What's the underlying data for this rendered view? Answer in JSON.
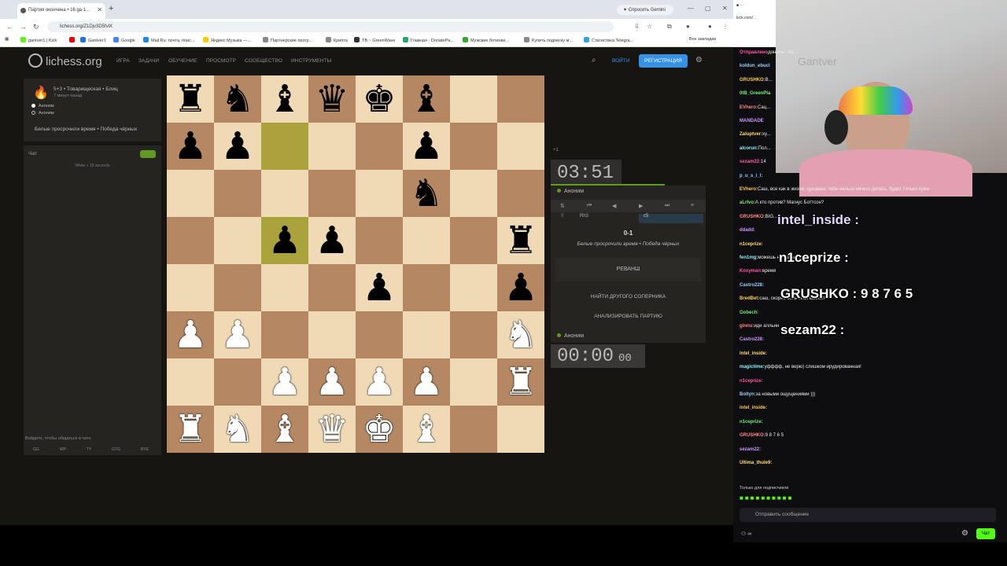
{
  "browser": {
    "tab_title": "Партия окончена • 16:ga 1...",
    "gemini": "Спросить Gemini",
    "url": "lichess.org/Z1Djv3D5fvlX",
    "bookmarks": [
      "gantver1 | Kick",
      "",
      "Gantver1",
      "Google",
      "Mail.Ru: почта, поис...",
      "Яндекс Музыка —...",
      "Партнерские прогр...",
      "Крипта",
      "TB ~ GreenWave",
      "Главная - DonatePa...",
      "Мужские ботинки...",
      "Купить подписку м...",
      "Статистика Telegra...",
      "Все закладки"
    ]
  },
  "lichess": {
    "logo": "lichess.org",
    "nav": [
      "ИГРА",
      "ЗАДАЧИ",
      "ОБУЧЕНИЕ",
      "ПРОСМОТР",
      "СООБЩЕСТВО",
      "ИНСТРУМЕНТЫ"
    ],
    "login": "ВОЙТИ",
    "register": "РЕГИСТРАЦИЯ"
  },
  "game": {
    "type": "5+3 • Товарищеская • Блиц",
    "time_ago": "7 минут назад",
    "white_player": "Аноним",
    "black_player": "Аноним",
    "result_text": "Белые просрочили время • Победа чёрных",
    "score": "0-1",
    "move_no": "9",
    "move_white": "Rh3",
    "move_black": "c5",
    "top_clock": "03:51",
    "bottom_clock": "00:00",
    "bottom_clock_tenths": "00",
    "top_player": "Аноним",
    "bottom_player": "Аноним",
    "rematch": "РЕВАНШ",
    "new_opponent": "НАЙТИ ДРУГОГО СОПЕРНИКА",
    "analyze": "АНАЛИЗИРОВАТЬ ПАРТИЮ",
    "plus": "+1"
  },
  "chat": {
    "title": "Чат",
    "notice": "White + 15 seconds",
    "placeholder": "Войдите, чтобы общаться в чате",
    "quick": [
      "GG",
      "WP",
      "TY",
      "GTG",
      "BYE"
    ]
  },
  "board": [
    [
      "bR",
      "bN",
      "bB",
      "bQ",
      "bK",
      "bB",
      "",
      ""
    ],
    [
      "bP",
      "bP",
      "",
      "",
      "",
      "bP",
      "",
      ""
    ],
    [
      "",
      "",
      "",
      "",
      "",
      "bN",
      "",
      ""
    ],
    [
      "",
      "",
      "bP",
      "bP",
      "",
      "",
      "",
      "bR"
    ],
    [
      "",
      "",
      "",
      "",
      "bP",
      "",
      "",
      "bP"
    ],
    [
      "wP",
      "wP",
      "",
      "",
      "",
      "",
      "",
      "wN"
    ],
    [
      "",
      "",
      "wP",
      "wP",
      "wP",
      "wP",
      "",
      "wR"
    ],
    [
      "wR",
      "wN",
      "wB",
      "wQ",
      "wK",
      "wB",
      "",
      ""
    ]
  ],
  "highlights": [
    "c7",
    "c5"
  ],
  "stream": {
    "pip_site": "kick.com/...",
    "messages": [
      {
        "user": "Отправлено",
        "text": "донаты - htt..."
      },
      {
        "user": "koldun_ebucl",
        "text": ""
      },
      {
        "user": "GRUSHKO:",
        "text": "В..."
      },
      {
        "user": "0tB_GreenPla",
        "text": ""
      },
      {
        "user": "EVhero:",
        "text": "Сац..."
      },
      {
        "user": "MANDADE",
        "text": ""
      },
      {
        "user": "Zaluptver:",
        "text": "ху..."
      },
      {
        "user": "alcorun:",
        "text": "Пол..."
      },
      {
        "user": "sezam22:",
        "text": "14"
      },
      {
        "user": "p_u_s_i_l:",
        "text": ""
      },
      {
        "user": "EVhero:",
        "text": "Саш, все как в жизни, цукцванг, тебе нельзя ничего делать, будет только хуже"
      },
      {
        "user": "aLrIvo:",
        "text": "А кто против? Магнус Боттсон?"
      },
      {
        "user": "GRUSHKO:",
        "text": "BIG..."
      },
      {
        "user": "ddadd:",
        "text": ""
      },
      {
        "user": "n1ceprize:",
        "text": ""
      },
      {
        "user": "fen1mg:",
        "text": "можешь но только жопой"
      },
      {
        "user": "Koxyman:",
        "text": "время"
      },
      {
        "user": "Castro228:",
        "text": ""
      },
      {
        "user": "BredBet:",
        "text": "саш, скорее конь тебя выебет"
      },
      {
        "user": "Gobech:",
        "text": ""
      },
      {
        "user": "ginnu:",
        "text": "иди алльин"
      },
      {
        "user": "Castro228:",
        "text": ""
      },
      {
        "user": "intel_inside:",
        "text": ""
      },
      {
        "user": "magictime:",
        "text": "уфффф, не верю) слишком ирудированная!"
      },
      {
        "user": "n1ceprize:",
        "text": ""
      },
      {
        "user": "Boltyn:",
        "text": "за новыми ощущениями )))"
      },
      {
        "user": "intel_inside:",
        "text": ""
      },
      {
        "user": "n1ceprize:",
        "text": ""
      },
      {
        "user": "GRUSHKO:",
        "text": "9 8 7 6 5"
      },
      {
        "user": "sezam22:",
        "text": ""
      },
      {
        "user": "Ultima_thule9:",
        "text": ""
      }
    ],
    "overlays": [
      {
        "text": "intel_inside :"
      },
      {
        "text": "n1ceprize :"
      },
      {
        "text": "GRUSHKO : 9 8 7 6 5"
      },
      {
        "text": "sezam22 :"
      }
    ],
    "sub_note": "Только для подписчиков",
    "send_placeholder": "Отправить сообщение",
    "chat_button": "Чат"
  },
  "colors": {
    "bg": "#161512",
    "light_square": "#f0d9b5",
    "dark_square": "#b58863",
    "highlight": "#aaa23a",
    "accent": "#3692e7",
    "kick_green": "#53fc18"
  }
}
